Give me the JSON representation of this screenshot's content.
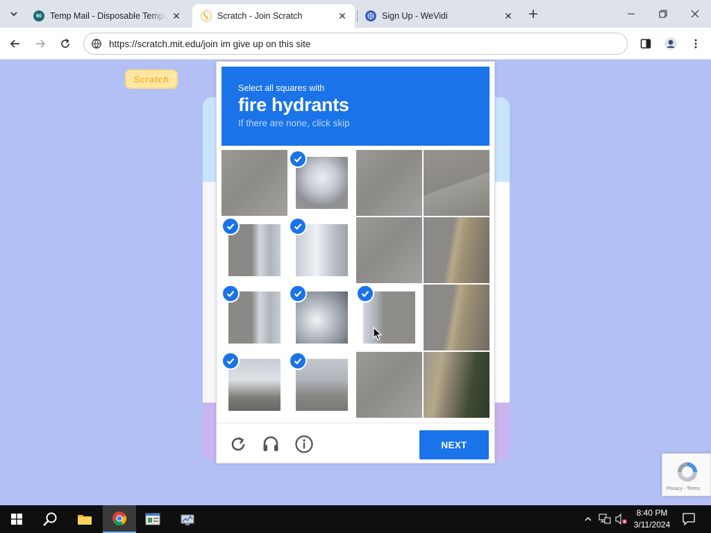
{
  "tabs": [
    {
      "title": "Temp Mail - Disposable Temporary Email",
      "favicon": "temp-mail-icon"
    },
    {
      "title": "Scratch - Join Scratch",
      "favicon": "scratch-icon"
    },
    {
      "title": "Sign Up - WeVidi",
      "favicon": "wevidi-icon"
    }
  ],
  "tab_temp_favicon_text": "60",
  "address_bar": {
    "url": "https://scratch.mit.edu/join im give up on this site"
  },
  "page": {
    "logo_text": "Scratch"
  },
  "captcha": {
    "instruction": "Select all squares with",
    "target": "fire hydrants",
    "hint": "If there are none, click skip",
    "next_label": "NEXT",
    "tiles": [
      {
        "row": 0,
        "col": 0,
        "selected": false,
        "content": "pavement"
      },
      {
        "row": 0,
        "col": 1,
        "selected": true,
        "content": "hydrant-top"
      },
      {
        "row": 0,
        "col": 2,
        "selected": false,
        "content": "pavement"
      },
      {
        "row": 0,
        "col": 3,
        "selected": false,
        "content": "pavement-crack"
      },
      {
        "row": 1,
        "col": 0,
        "selected": true,
        "content": "hydrant-side"
      },
      {
        "row": 1,
        "col": 1,
        "selected": true,
        "content": "hydrant-body"
      },
      {
        "row": 1,
        "col": 2,
        "selected": false,
        "content": "pavement"
      },
      {
        "row": 1,
        "col": 3,
        "selected": false,
        "content": "curb"
      },
      {
        "row": 2,
        "col": 0,
        "selected": true,
        "content": "hydrant-side"
      },
      {
        "row": 2,
        "col": 1,
        "selected": true,
        "content": "hydrant-nozzle"
      },
      {
        "row": 2,
        "col": 2,
        "selected": true,
        "content": "hydrant-edge"
      },
      {
        "row": 2,
        "col": 3,
        "selected": false,
        "content": "curb"
      },
      {
        "row": 3,
        "col": 0,
        "selected": true,
        "content": "hydrant-base"
      },
      {
        "row": 3,
        "col": 1,
        "selected": true,
        "content": "hydrant-chain"
      },
      {
        "row": 3,
        "col": 2,
        "selected": false,
        "content": "pavement"
      },
      {
        "row": 3,
        "col": 3,
        "selected": false,
        "content": "curb-grass"
      }
    ]
  },
  "recaptcha_badge": {
    "text": "Privacy - Terms"
  },
  "taskbar": {
    "time": "8:40 PM",
    "date": "3/11/2024"
  },
  "colors": {
    "accent": "#1a73e8",
    "page_bg": "#b3c0f5"
  }
}
